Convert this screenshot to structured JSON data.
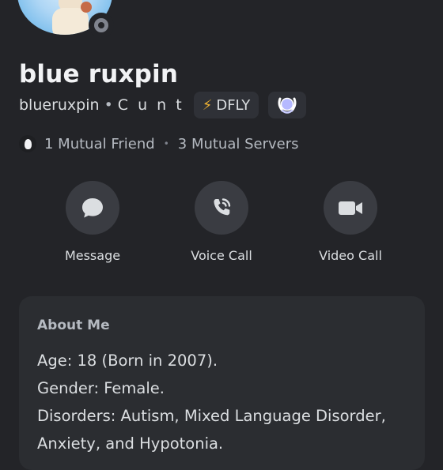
{
  "profile": {
    "display_name": "blue ruxpin",
    "username": "blueruxpin",
    "separator": "•",
    "pronouns": "C u n t",
    "guild_tag": {
      "icon": "lightning-bolt-icon",
      "label": "DFLY"
    },
    "badge": "laurel-badge-icon",
    "status": "offline"
  },
  "mutuals": {
    "friends_label": "1 Mutual Friend",
    "separator": "•",
    "servers_label": "3 Mutual Servers"
  },
  "actions": [
    {
      "label": "Message",
      "icon": "chat-bubble-icon"
    },
    {
      "label": "Voice Call",
      "icon": "phone-icon"
    },
    {
      "label": "Video Call",
      "icon": "video-camera-icon"
    }
  ],
  "about": {
    "title": "About Me",
    "lines": [
      "Age: 18 (Born in 2007).",
      "Gender: Female.",
      "Disorders: Autism, Mixed Language Disorder,",
      "Anxiety, and Hypotonia."
    ]
  },
  "colors": {
    "background": "#232428",
    "card": "#2b2d31",
    "chip": "#2f3137",
    "button": "#3a3c42",
    "status_offline": "#80848e",
    "bolt": "#f0b232",
    "badge": "#b5b9ff"
  }
}
